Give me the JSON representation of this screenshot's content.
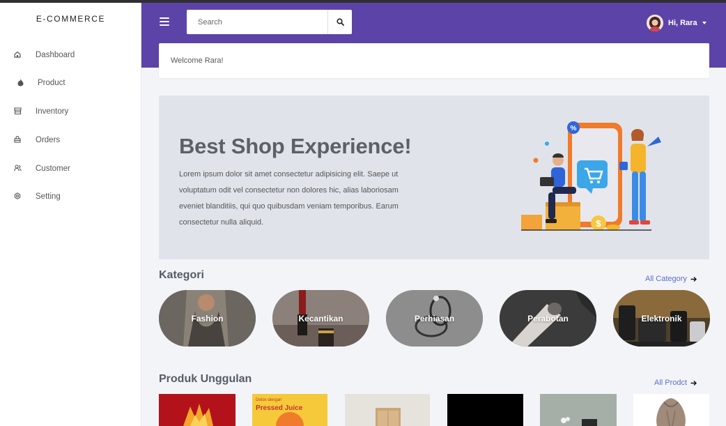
{
  "sidebar": {
    "brand": "E-COMMERCE",
    "items": [
      {
        "label": "Dashboard",
        "icon": "home-icon"
      },
      {
        "label": "Product",
        "icon": "flame-icon"
      },
      {
        "label": "Inventory",
        "icon": "storefront-icon"
      },
      {
        "label": "Orders",
        "icon": "basket-icon"
      },
      {
        "label": "Customer",
        "icon": "users-icon"
      },
      {
        "label": "Setting",
        "icon": "gear-icon"
      }
    ]
  },
  "header": {
    "search_placeholder": "Search",
    "user_greeting": "Hi, Rara",
    "bg_color": "#5c43a8"
  },
  "welcome": {
    "text": "Welcome Rara!"
  },
  "hero": {
    "title": "Best Shop Experience!",
    "text": "Lorem ipsum dolor sit amet consectetur adipisicing elit. Saepe ut voluptatum odit vel consectetur non dolores hic, alias laboriosam eveniet blanditiis, qui quo quibusdam veniam temporibus. Earum consectetur nulla aliquid."
  },
  "categories": {
    "title": "Kategori",
    "link": "All Category",
    "items": [
      {
        "label": "Fashion"
      },
      {
        "label": "Kecantikan"
      },
      {
        "label": "Perhiasan"
      },
      {
        "label": "Perabotan"
      },
      {
        "label": "Elektronik"
      }
    ]
  },
  "products": {
    "title": "Produk Unggulan",
    "link": "All Prodct",
    "items": [
      {
        "name": "product-1"
      },
      {
        "name": "product-2",
        "caption_top": "Detox dengan",
        "caption_main": "Pressed Juice"
      },
      {
        "name": "product-3"
      },
      {
        "name": "product-4"
      },
      {
        "name": "product-5"
      },
      {
        "name": "product-6"
      }
    ]
  },
  "colors": {
    "accent": "#5c43a8",
    "link": "#5a6fd0",
    "hero_bg": "#e0e4ea"
  }
}
